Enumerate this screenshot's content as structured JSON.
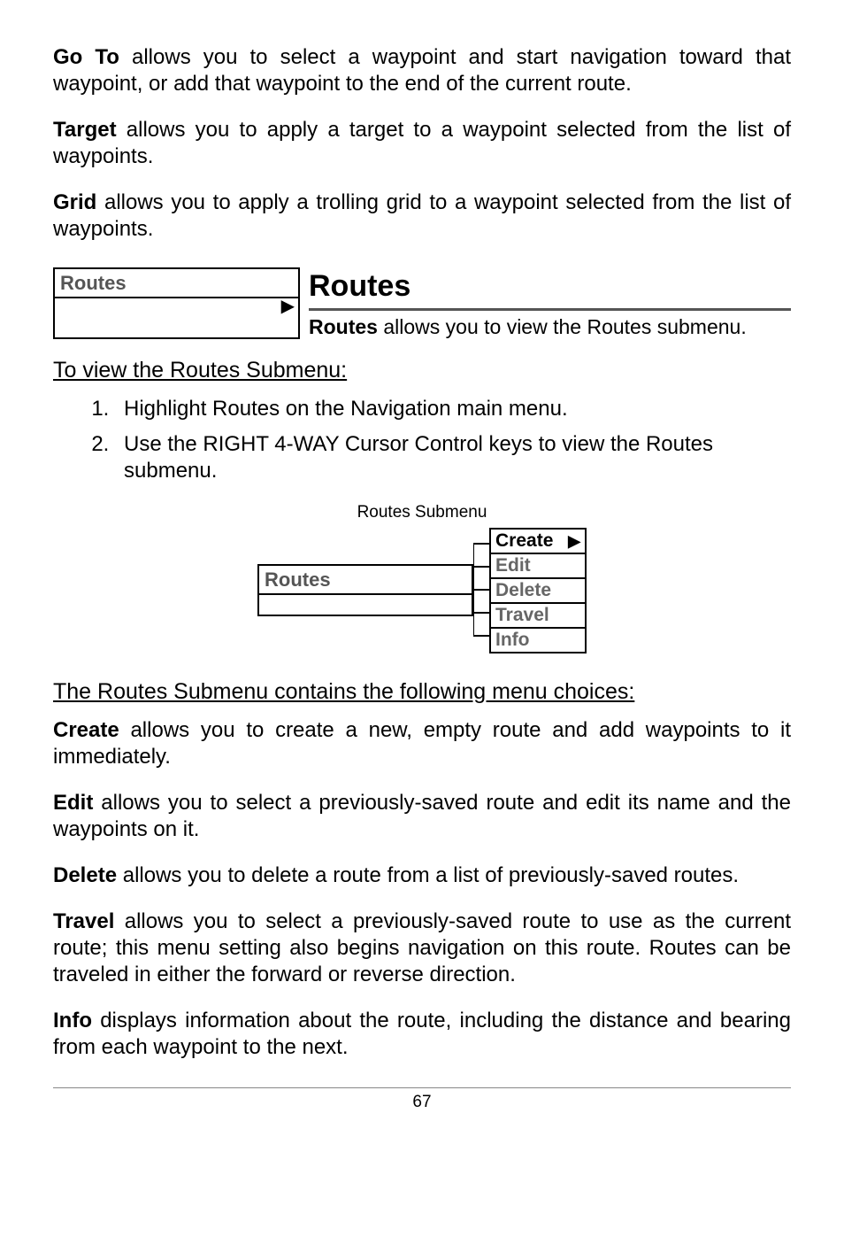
{
  "p1": {
    "label": "Go To",
    "text": " allows you to select a waypoint and start navigation toward that waypoint, or add that waypoint to the end of the current route."
  },
  "p2": {
    "label": "Target",
    "text": " allows you to apply a target to a waypoint selected from the list of waypoints."
  },
  "p3": {
    "label": "Grid",
    "text": " allows you to apply a trolling grid to a waypoint selected from the list of waypoints."
  },
  "routesBox": {
    "label": "Routes"
  },
  "sectionTitle": "Routes",
  "sectionSub": {
    "label": "Routes",
    "text": " allows you to view the Routes submenu."
  },
  "viewHeading": "To view the Routes Submenu:",
  "steps": [
    "Highlight Routes on the Navigation main menu.",
    "Use the RIGHT 4-WAY Cursor Control keys to view the Routes submenu."
  ],
  "submenuCaption": "Routes Submenu",
  "submenuLeftLabel": "Routes",
  "submenuItems": [
    {
      "label": "Create",
      "active": true,
      "arrow": true
    },
    {
      "label": "Edit",
      "active": false,
      "arrow": false
    },
    {
      "label": "Delete",
      "active": false,
      "arrow": false
    },
    {
      "label": "Travel",
      "active": false,
      "arrow": false
    },
    {
      "label": "Info",
      "active": false,
      "arrow": false
    }
  ],
  "choicesHeading": "The Routes Submenu contains the following menu choices:",
  "c1": {
    "label": "Create",
    "text": " allows you to create a new, empty route and add waypoints to it immediately."
  },
  "c2": {
    "label": "Edit",
    "text": " allows you to select a previously-saved route and edit its name and the waypoints on it."
  },
  "c3": {
    "label": "Delete",
    "text": " allows you to delete a route from a list of previously-saved routes."
  },
  "c4": {
    "label": "Travel",
    "text": " allows you to select a previously-saved route to use as the current route; this menu setting also begins navigation on this route. Routes can be traveled in either the forward or reverse direction."
  },
  "c5": {
    "label": "Info",
    "text": " displays information about the route, including the distance and bearing from each waypoint to the next."
  },
  "pageNumber": "67"
}
